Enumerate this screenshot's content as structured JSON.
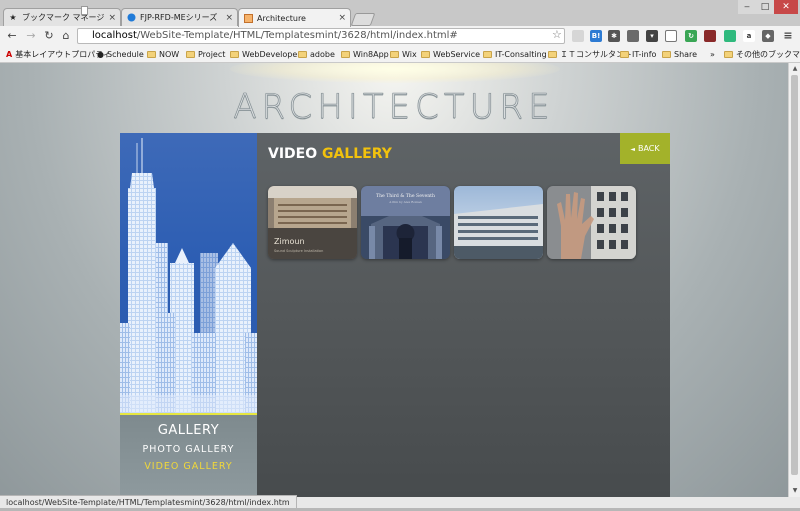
{
  "browser": {
    "tabs": [
      {
        "label": "ブックマーク マネージャ",
        "icon": "star-icon",
        "active": false
      },
      {
        "label": "FJP-RFD-MEシリーズ［従来",
        "icon": "globe-icon",
        "active": false
      },
      {
        "label": "Architecture",
        "icon": "page-icon",
        "active": true
      }
    ],
    "close_glyph": "×",
    "url_host": "localhost",
    "url_path": "/WebSite-Template/HTML/Templatesmint/3628/html/index.html#",
    "status_url": "localhost/WebSite-Template/HTML/Templatesmint/3628/html/index.htm",
    "extensions": [
      {
        "name": "ext-b-icon",
        "label": "B!",
        "color": "#2d7bd3"
      },
      {
        "name": "ext-puzzle-icon",
        "label": "✱",
        "color": "#555555"
      },
      {
        "name": "ext-pocket-icon",
        "label": "▾",
        "color": "#444444"
      },
      {
        "name": "ext-green-icon",
        "label": "↻",
        "color": "#3aa655"
      },
      {
        "name": "ext-amazon-icon",
        "label": "a",
        "color": "#333333"
      },
      {
        "name": "ext-shield-icon",
        "label": "◆",
        "color": "#666666"
      }
    ],
    "bookmarks": [
      {
        "label": "基本レイアウトプロパティ",
        "type": "adobe"
      },
      {
        "label": "Schedule",
        "type": "apple"
      },
      {
        "label": "NOW",
        "type": "folder"
      },
      {
        "label": "Project",
        "type": "folder"
      },
      {
        "label": "WebDeveloper",
        "type": "folder"
      },
      {
        "label": "adobe",
        "type": "folder"
      },
      {
        "label": "Win8App",
        "type": "folder"
      },
      {
        "label": "Wix",
        "type": "folder"
      },
      {
        "label": "WebService",
        "type": "folder"
      },
      {
        "label": "IT-Consalting",
        "type": "folder"
      },
      {
        "label": "ＩＴコンサルタント",
        "type": "folder"
      },
      {
        "label": "IT-info",
        "type": "folder"
      },
      {
        "label": "Share",
        "type": "folder"
      },
      {
        "label": "»",
        "type": "more"
      },
      {
        "label": "その他のブックマーク",
        "type": "folder"
      }
    ]
  },
  "site": {
    "title": "ARCHITECTURE",
    "back_label": "BACK",
    "gallery_title_primary": "VIDEO",
    "gallery_title_accent": "GALLERY",
    "menu": {
      "heading": "GALLERY",
      "items": [
        {
          "label": "PHOTO GALLERY",
          "active": false
        },
        {
          "label": "VIDEO GALLERY",
          "active": true
        }
      ]
    },
    "thumbnails": [
      {
        "name": "video-thumb-zimoun",
        "caption": "Zimoun",
        "subcaption": "Sound Sculpture Installation"
      },
      {
        "name": "video-thumb-third-seventh",
        "caption": "The Third & The Seventh",
        "subcaption": "A film by Alex Roman"
      },
      {
        "name": "video-thumb-building",
        "caption": "",
        "subcaption": ""
      },
      {
        "name": "video-thumb-hand",
        "caption": "",
        "subcaption": ""
      }
    ]
  },
  "colors": {
    "accent_yellow": "#f2c20d",
    "back_green": "#a3b22a",
    "sidebar_blue": "#2d5eb3"
  }
}
